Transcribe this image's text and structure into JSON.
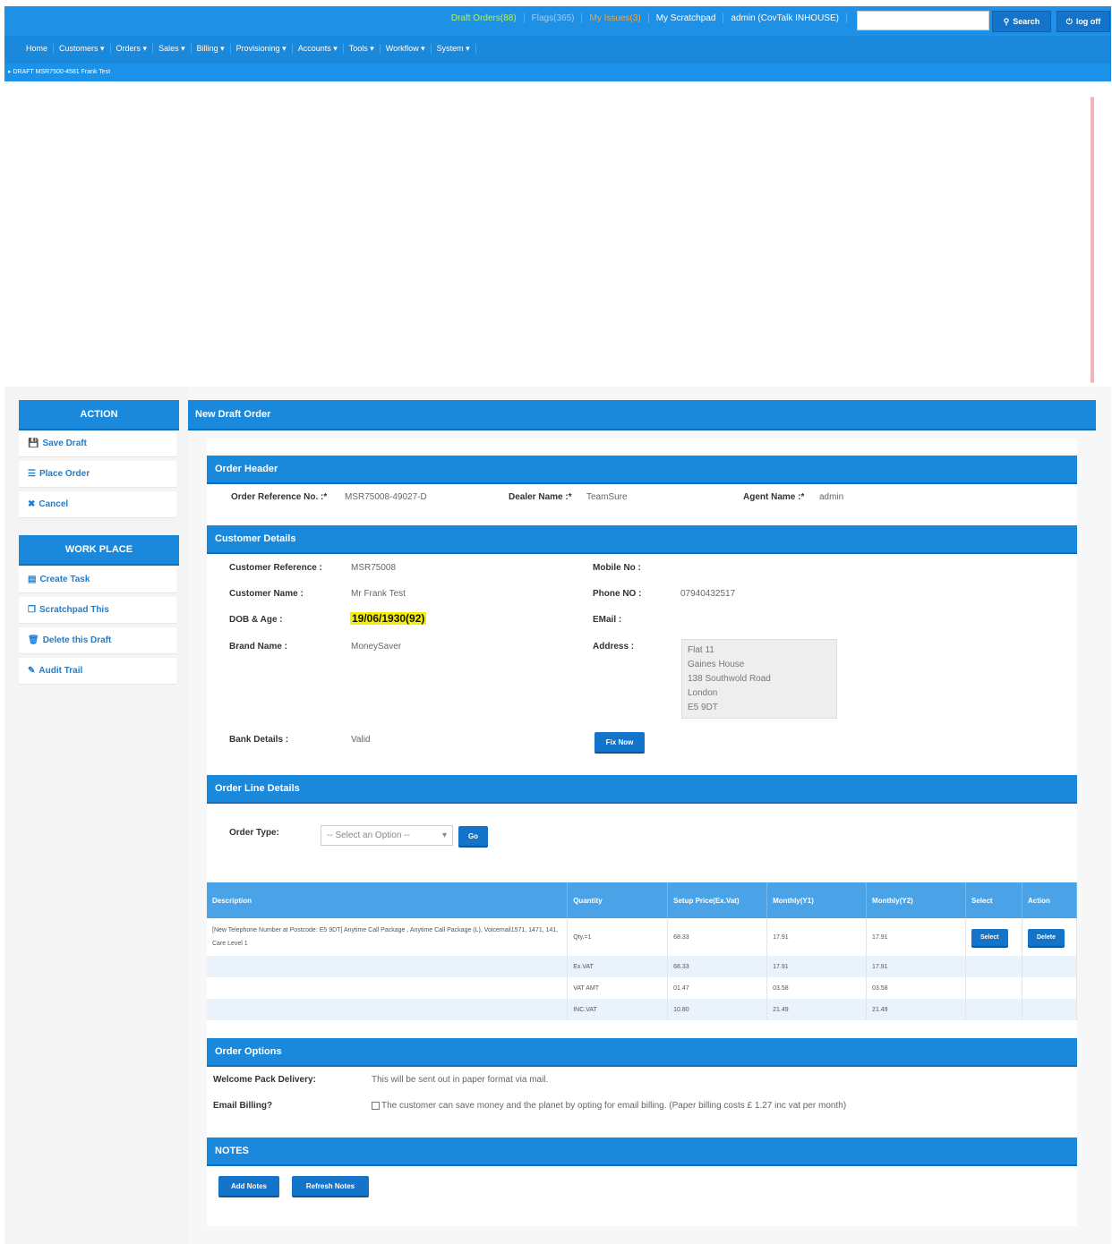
{
  "topbar": {
    "links": [
      {
        "label": "Draft Orders(88)",
        "color": "green"
      },
      {
        "label": "Flags(365)",
        "color": "muted"
      },
      {
        "label": "My Issues(3)",
        "color": "orange"
      },
      {
        "label": "My Scratchpad",
        "color": "white"
      },
      {
        "label": "admin (CovTalk INHOUSE)",
        "color": "white"
      }
    ],
    "search_label": "Search",
    "logoff_label": "log off"
  },
  "nav": {
    "items": [
      "Home",
      "Customers ▾",
      "Orders ▾",
      "Sales ▾",
      "Billing ▾",
      "Provisioning ▾",
      "Accounts ▾",
      "Tools ▾",
      "Workflow ▾",
      "System ▾"
    ]
  },
  "breadcrumb": "DRAFT MSR7500-4581 Frank Test",
  "sidebar": {
    "action_title": "ACTION",
    "action_items": [
      {
        "icon": "save-icon",
        "label": "Save Draft"
      },
      {
        "icon": "list-icon",
        "label": "Place Order"
      },
      {
        "icon": "close-icon",
        "label": "Cancel"
      }
    ],
    "workplace_title": "WORK PLACE",
    "workplace_items": [
      {
        "icon": "task-icon",
        "label": "Create Task"
      },
      {
        "icon": "copy-icon",
        "label": "Scratchpad This"
      },
      {
        "icon": "trash-icon",
        "label": "Delete this Draft"
      },
      {
        "icon": "edit-icon",
        "label": "Audit Trail"
      }
    ]
  },
  "main": {
    "title": "New Draft Order",
    "order_header": {
      "title": "Order Header",
      "ref_label": "Order Reference No. :*",
      "ref_value": "MSR75008-49027-D",
      "dealer_label": "Dealer Name :*",
      "dealer_value": "TeamSure",
      "agent_label": "Agent Name :*",
      "agent_value": "admin"
    },
    "customer": {
      "title": "Customer Details",
      "ref_label": "Customer Reference :",
      "ref_value": "MSR75008",
      "mobile_label": "Mobile No :",
      "mobile_value": "",
      "name_label": "Customer Name :",
      "name_value": "Mr Frank Test",
      "phone_label": "Phone NO :",
      "phone_value": "07940432517",
      "dob_label": "DOB & Age :",
      "dob_value": "19/06/1930(92)",
      "email_label": "EMail :",
      "brand_label": "Brand Name :",
      "brand_value": "MoneySaver",
      "address_label": "Address :",
      "address_lines": [
        "Flat 11",
        "Gaines House",
        "138 Southwold Road",
        "London",
        "E5 9DT"
      ],
      "bank_label": "Bank Details :",
      "bank_value": "Valid",
      "fix_label": "Fix Now"
    },
    "order_lines": {
      "title": "Order Line Details",
      "type_label": "Order Type:",
      "type_placeholder": "-- Select an Option --",
      "go_label": "Go",
      "columns": [
        "Description",
        "Quantity",
        "Setup Price(Ex.Vat)",
        "Monthly(Y1)",
        "Monthly(Y2)",
        "Select",
        "Action"
      ],
      "description": "[New Telephone Number at Postcode: E5 9DT] Anytime Call Package , Anytime Call Package (L), Voicemail1571, 1471, 141, Care Level 1",
      "rows": [
        {
          "qty": "Qty.=1",
          "setup": "68.33",
          "m1": "17.91",
          "m2": "17.91"
        },
        {
          "qty": "Ex.VAT",
          "setup": "68.33",
          "m1": "17.91",
          "m2": "17.91"
        },
        {
          "qty": "VAT AMT",
          "setup": "01.47",
          "m1": "03.58",
          "m2": "03.58"
        },
        {
          "qty": "INC.VAT",
          "setup": "10.80",
          "m1": "21.49",
          "m2": "21.49"
        }
      ],
      "select_label": "Select",
      "delete_label": "Delete"
    },
    "options": {
      "title": "Order Options",
      "welcome_label": "Welcome Pack Delivery:",
      "welcome_value": "This will be sent out in paper format via mail.",
      "email_label": "Email Billing?",
      "email_text": "The customer can save money and the planet by opting for email billing. (Paper billing costs £ 1.27 inc vat per month)"
    },
    "notes": {
      "title": "NOTES",
      "add_label": "Add Notes",
      "refresh_label": "Refresh Notes"
    }
  },
  "colors": {
    "primary": "#1a89dc",
    "button": "#1374c9",
    "highlight": "#f6f000"
  }
}
